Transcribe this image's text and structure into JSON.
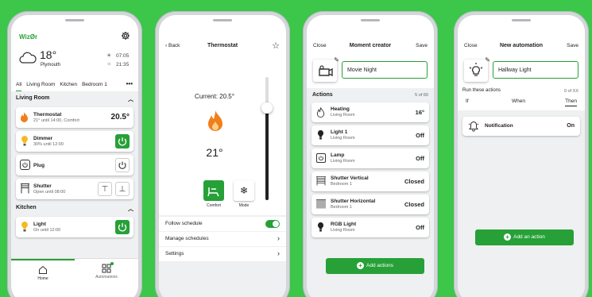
{
  "colors": {
    "background": "#3cc64a",
    "accent": "#27a038",
    "flame": "#f07f1a",
    "bulb": "#f5b820"
  },
  "home": {
    "logo": "Wiz",
    "weather": {
      "temp": "18°",
      "city": "Plymouth",
      "sunrise": "07:05",
      "sunset": "21:35",
      "icon": "cloud-icon"
    },
    "tabs": [
      "All",
      "Living Room",
      "Kitchen",
      "Bedroom 1"
    ],
    "sections": [
      {
        "title": "Living Room"
      },
      {
        "title": "Kitchen"
      }
    ],
    "devices": [
      {
        "name": "Thermostat",
        "status": "21° until 14:00, Comfort",
        "value": "20.5°",
        "icon": "flame-icon"
      },
      {
        "name": "Dimmer",
        "status": "30% until 12:00",
        "icon": "bulb-icon"
      },
      {
        "name": "Plug",
        "status": "",
        "icon": "plug-icon"
      },
      {
        "name": "Shutter",
        "status": "Open until 08:00",
        "icon": "shutter-icon"
      },
      {
        "name": "Light",
        "status": "On until 12:00",
        "icon": "bulb-icon"
      }
    ],
    "nav": {
      "home": "Home",
      "automations": "Automations"
    }
  },
  "thermostat": {
    "back": "Back",
    "title": "Thermostat",
    "current": "Current: 20.5°",
    "setpoint": "21°",
    "modes": [
      {
        "label": "Comfort"
      },
      {
        "label": "Mode"
      }
    ],
    "slider_level": 0.75,
    "rows": [
      {
        "label": "Follow schedule"
      },
      {
        "label": "Manage schedules"
      },
      {
        "label": "Settings"
      }
    ]
  },
  "moment": {
    "close": "Close",
    "title": "Moment creator",
    "save": "Save",
    "name": "Movie Night",
    "actions_title": "Actions",
    "count": "5 of 60",
    "items": [
      {
        "name": "Heating",
        "room": "Living Room",
        "value": "16°",
        "icon": "heating-icon"
      },
      {
        "name": "Light 1",
        "room": "Living Room",
        "value": "Off",
        "icon": "bulb-icon"
      },
      {
        "name": "Lamp",
        "room": "Living Room",
        "value": "Off",
        "icon": "plug-icon"
      },
      {
        "name": "Shutter Vertical",
        "room": "Bedroom 1",
        "value": "Closed",
        "icon": "shutter-icon"
      },
      {
        "name": "Shutter Horizontal",
        "room": "Bedroom 1",
        "value": "Closed",
        "icon": "shutter-icon"
      },
      {
        "name": "RGB Light",
        "room": "Living Room",
        "value": "Off",
        "icon": "bulb-icon"
      }
    ],
    "add_label": "Add actions"
  },
  "automation": {
    "close": "Close",
    "title": "New automation",
    "save": "Save",
    "name": "Hallway Light",
    "run_label": "Run these actions",
    "count": "0 of XX",
    "tabs": [
      "If",
      "When",
      "Then"
    ],
    "notification": {
      "label": "Notification",
      "value": "On"
    },
    "add_label": "Add an action"
  }
}
